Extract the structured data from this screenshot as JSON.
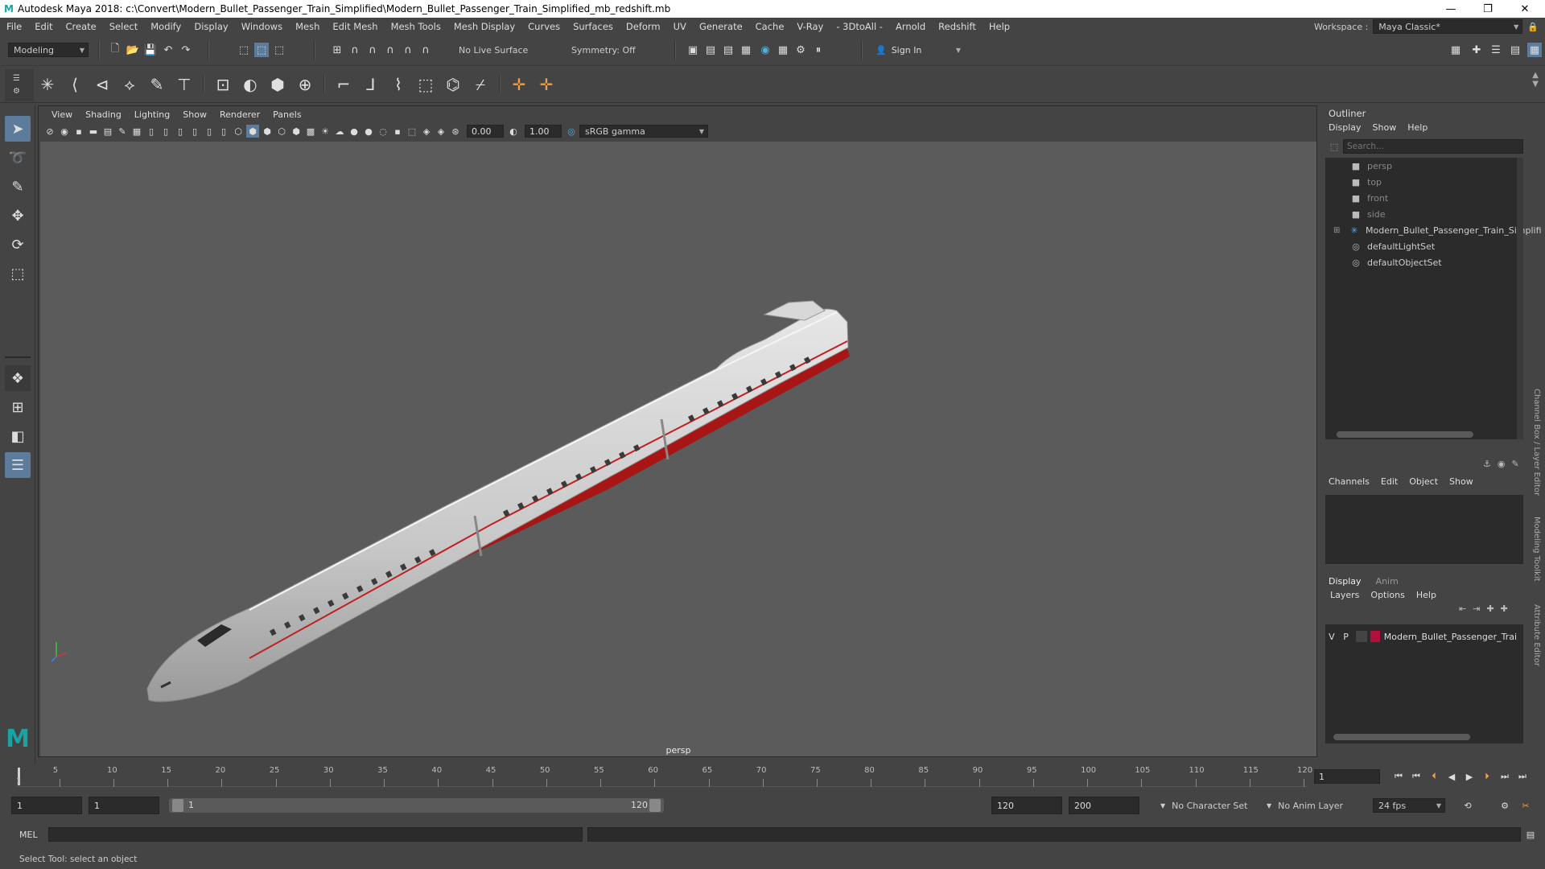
{
  "titlebar": {
    "title": "Autodesk Maya 2018: c:\\Convert\\Modern_Bullet_Passenger_Train_Simplified\\Modern_Bullet_Passenger_Train_Simplified_mb_redshift.mb",
    "logo": "M",
    "minimize": "—",
    "maximize": "❐",
    "close": "✕"
  },
  "menubar": {
    "items": [
      "File",
      "Edit",
      "Create",
      "Select",
      "Modify",
      "Display",
      "Windows",
      "Mesh",
      "Edit Mesh",
      "Mesh Tools",
      "Mesh Display",
      "Curves",
      "Surfaces",
      "Deform",
      "UV",
      "Generate",
      "Cache",
      "V-Ray",
      "- 3DtoAll -",
      "Arnold",
      "Redshift",
      "Help"
    ],
    "workspace_label": "Workspace :",
    "workspace_value": "Maya Classic*"
  },
  "statusline": {
    "mode": "Modeling",
    "live_surface": "No Live Surface",
    "symmetry": "Symmetry: Off",
    "sign_in": "Sign In"
  },
  "panel": {
    "menus": [
      "View",
      "Shading",
      "Lighting",
      "Show",
      "Renderer",
      "Panels"
    ],
    "exposure": "0.00",
    "gamma": "1.00",
    "colorspace": "sRGB gamma",
    "camera": "persp"
  },
  "outliner": {
    "title": "Outliner",
    "menus": [
      "Display",
      "Show",
      "Help"
    ],
    "search_placeholder": "Search...",
    "items": [
      {
        "label": "persp",
        "icon": "camera-icon",
        "dim": true
      },
      {
        "label": "top",
        "icon": "camera-icon",
        "dim": true
      },
      {
        "label": "front",
        "icon": "camera-icon",
        "dim": true
      },
      {
        "label": "side",
        "icon": "camera-icon",
        "dim": true
      },
      {
        "label": "Modern_Bullet_Passenger_Train_Simplifi",
        "icon": "group-icon",
        "dim": false
      },
      {
        "label": "defaultLightSet",
        "icon": "set-icon",
        "dim": false
      },
      {
        "label": "defaultObjectSet",
        "icon": "set-icon",
        "dim": false
      }
    ]
  },
  "channelbox": {
    "menus": [
      "Channels",
      "Edit",
      "Object",
      "Show"
    ]
  },
  "layereditor": {
    "tabs": [
      "Display",
      "Anim"
    ],
    "menus": [
      "Layers",
      "Options",
      "Help"
    ],
    "layer": {
      "v": "V",
      "p": "P",
      "name": "Modern_Bullet_Passenger_Trai",
      "color": "#b0103a"
    }
  },
  "sidetabs": {
    "channel": "Channel Box / Layer Editor",
    "modeling": "Modeling Toolkit",
    "attribute": "Attribute Editor"
  },
  "timeslider": {
    "ticks": [
      "5",
      "10",
      "15",
      "20",
      "25",
      "30",
      "35",
      "40",
      "45",
      "50",
      "55",
      "60",
      "65",
      "70",
      "75",
      "80",
      "85",
      "90",
      "95",
      "100",
      "105",
      "110",
      "115",
      "120"
    ],
    "start_marker": "1",
    "current_frame": "1"
  },
  "rangeslider": {
    "start": "1",
    "playback_start": "1",
    "range_start": "1",
    "range_end": "120",
    "playback_end": "120",
    "end": "200",
    "character_set": "No Character Set",
    "anim_layer": "No Anim Layer",
    "fps": "24 fps"
  },
  "cmdline": {
    "label": "MEL"
  },
  "helpline": {
    "text": "Select Tool: select an object"
  },
  "colors": {
    "accent": "#5d7b9b",
    "train_red": "#b01818",
    "viewport_bg": "#5b5b5b"
  }
}
